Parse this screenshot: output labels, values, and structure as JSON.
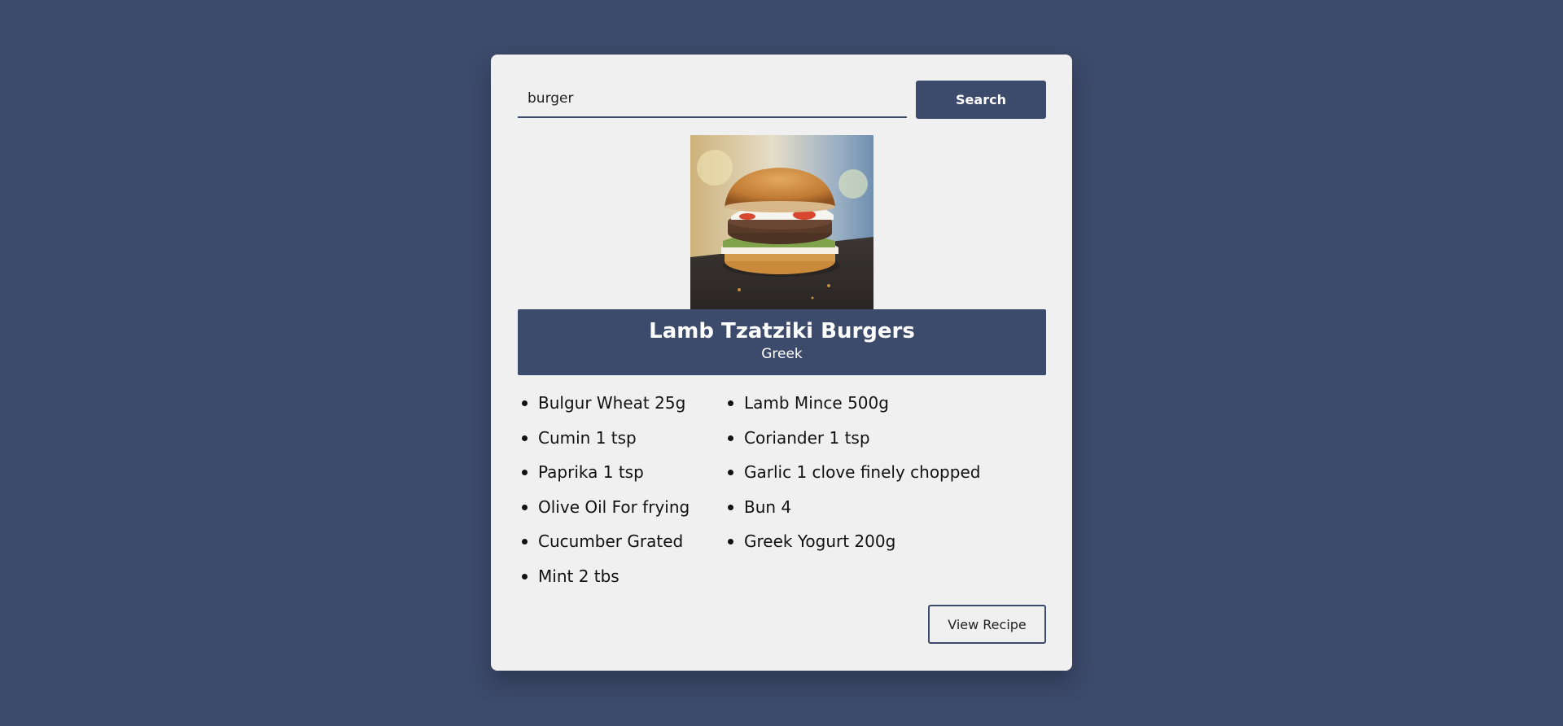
{
  "search": {
    "value": "burger",
    "button_label": "Search"
  },
  "meal": {
    "title": "Lamb Tzatziki Burgers",
    "area": "Greek",
    "image_alt": "burger photo"
  },
  "ingredients": {
    "left": [
      "Bulgur Wheat 25g",
      "Cumin 1 tsp",
      "Paprika 1 tsp",
      "Olive Oil For frying",
      "Cucumber Grated",
      "Mint 2 tbs"
    ],
    "right": [
      "Lamb Mince 500g",
      "Coriander 1 tsp",
      "Garlic 1 clove finely chopped",
      "Bun 4",
      "Greek Yogurt 200g"
    ]
  },
  "actions": {
    "view_recipe_label": "View Recipe"
  },
  "colors": {
    "background": "#3c4a6b",
    "card": "#f0f0f0",
    "accent": "#3c4a6b"
  }
}
